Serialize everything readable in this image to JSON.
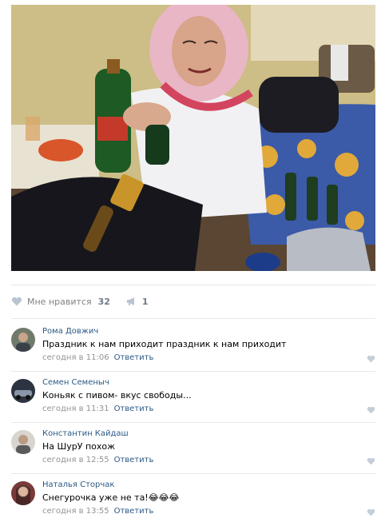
{
  "post": {
    "photo_alt": "",
    "likes": {
      "label": "Мне нравится",
      "count": "32"
    },
    "shares": {
      "count": "1"
    }
  },
  "comments": [
    {
      "author": "Рома Довжич",
      "text": "Праздник к нам приходит праздник к нам приходит",
      "time": "сегодня в 11:06",
      "reply": "Ответить",
      "emoji": ""
    },
    {
      "author": "Семен Семеныч",
      "text": "Коньяк с пивом- вкус свободы...",
      "time": "сегодня в 11:31",
      "reply": "Ответить",
      "emoji": ""
    },
    {
      "author": "Константин Кайдаш",
      "text": "На ШурУ похож",
      "time": "сегодня в 12:55",
      "reply": "Ответить",
      "emoji": ""
    },
    {
      "author": "Наталья Сторчак",
      "text": "Снегурочка уже не та!",
      "time": "сегодня в 13:55",
      "reply": "Ответить",
      "emoji": "😂😂😂"
    }
  ],
  "colors": {
    "link": "#2a5885",
    "muted": "#939393",
    "separator": "#e7e8ec"
  }
}
